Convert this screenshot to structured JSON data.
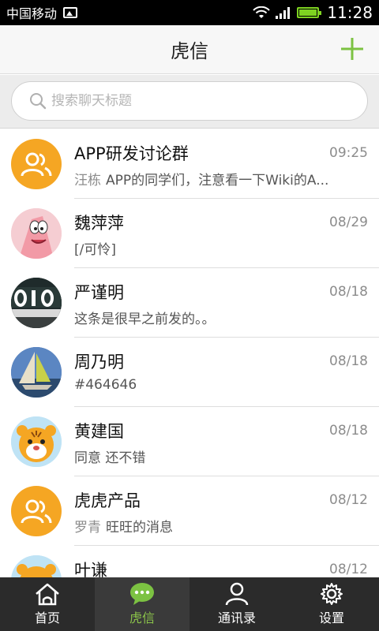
{
  "status_bar": {
    "carrier": "中国移动",
    "time": "11:28",
    "icons": [
      "image-icon",
      "wifi-icon",
      "signal-icon",
      "battery-icon"
    ]
  },
  "header": {
    "title": "虎信",
    "add_icon": "plus-icon"
  },
  "search": {
    "placeholder": "搜索聊天标题",
    "icon": "search-icon"
  },
  "chats": [
    {
      "name": "APP研发讨论群",
      "time": "09:25",
      "sender": "汪栋",
      "message": "APP的同学们，注意看一下Wiki的A...",
      "avatar": "group-avatar"
    },
    {
      "name": "魏萍萍",
      "time": "08/29",
      "sender": "",
      "message": "[/可怜]",
      "avatar": "starfish-avatar"
    },
    {
      "name": "严谨明",
      "time": "08/18",
      "sender": "",
      "message": "这条是很早之前发的。。",
      "avatar": "sign-avatar"
    },
    {
      "name": "周乃明",
      "time": "08/18",
      "sender": "",
      "message": "#464646",
      "avatar": "sailboat-avatar"
    },
    {
      "name": "黄建国",
      "time": "08/18",
      "sender": "",
      "message": "同意 还不错",
      "avatar": "tiger-avatar"
    },
    {
      "name": "虎虎产品",
      "time": "08/12",
      "sender": "罗青",
      "message": "旺旺的消息",
      "avatar": "group-avatar"
    },
    {
      "name": "叶谦",
      "time": "08/12",
      "sender": "",
      "message": "",
      "avatar": "tiger-avatar"
    }
  ],
  "nav": [
    {
      "label": "首页",
      "icon": "home-icon",
      "active": false
    },
    {
      "label": "虎信",
      "icon": "chat-icon",
      "active": true
    },
    {
      "label": "通讯录",
      "icon": "contacts-icon",
      "active": false
    },
    {
      "label": "设置",
      "icon": "gear-icon",
      "active": false
    }
  ],
  "colors": {
    "accent": "#8bc34a",
    "group_avatar": "#f5a623",
    "nav_bg": "#2b2b2b"
  }
}
